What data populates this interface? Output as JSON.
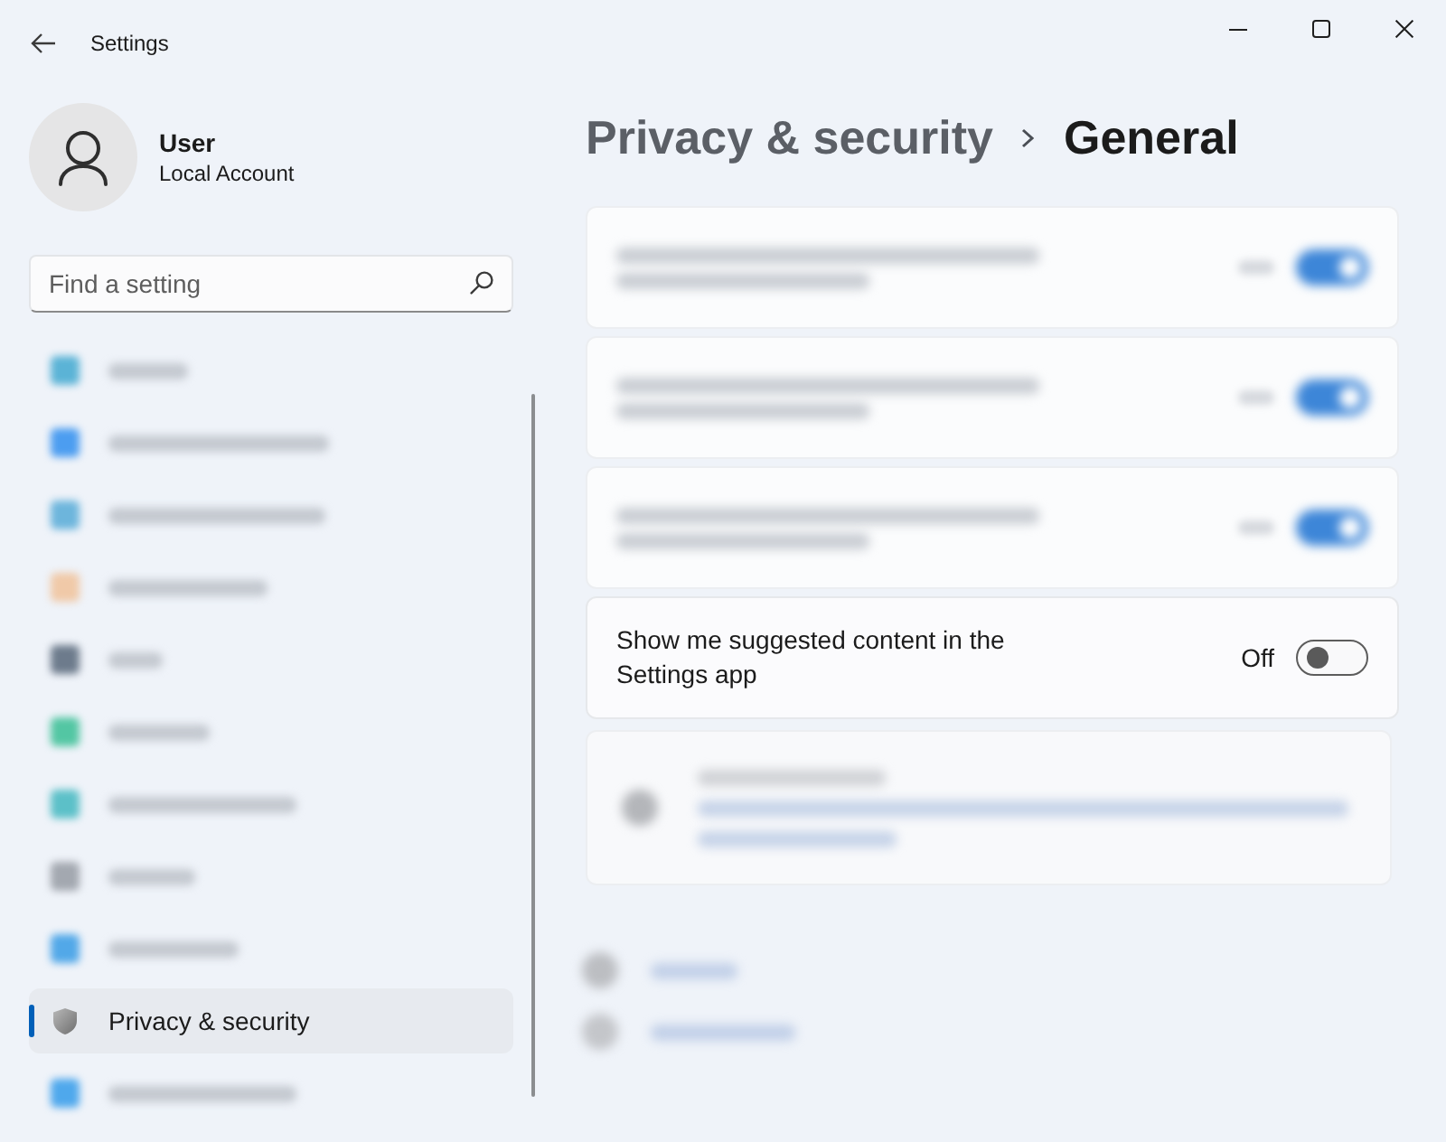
{
  "window": {
    "title": "Settings"
  },
  "account": {
    "name": "User",
    "type": "Local Account"
  },
  "search": {
    "placeholder": "Find a setting"
  },
  "nav_items": [
    {
      "kind": "blurred",
      "selected": false
    },
    {
      "kind": "blurred",
      "selected": false
    },
    {
      "kind": "blurred",
      "selected": false
    },
    {
      "kind": "blurred",
      "selected": false
    },
    {
      "kind": "blurred",
      "selected": false
    },
    {
      "kind": "blurred",
      "selected": false
    },
    {
      "kind": "blurred",
      "selected": false
    },
    {
      "kind": "blurred",
      "selected": false
    },
    {
      "kind": "blurred",
      "selected": false
    },
    {
      "kind": "item",
      "label": "Privacy & security",
      "selected": true
    },
    {
      "kind": "blurred",
      "selected": false
    }
  ],
  "breadcrumb": [
    {
      "label": "Privacy & security",
      "current": false
    },
    {
      "label": "General",
      "current": true
    }
  ],
  "settings": [
    {
      "kind": "blurred",
      "on": true
    },
    {
      "kind": "blurred",
      "on": true
    },
    {
      "kind": "blurred",
      "on": true
    },
    {
      "kind": "toggle",
      "label": "Show me suggested content in the Settings app",
      "state_text": "Off",
      "on": false
    }
  ]
}
